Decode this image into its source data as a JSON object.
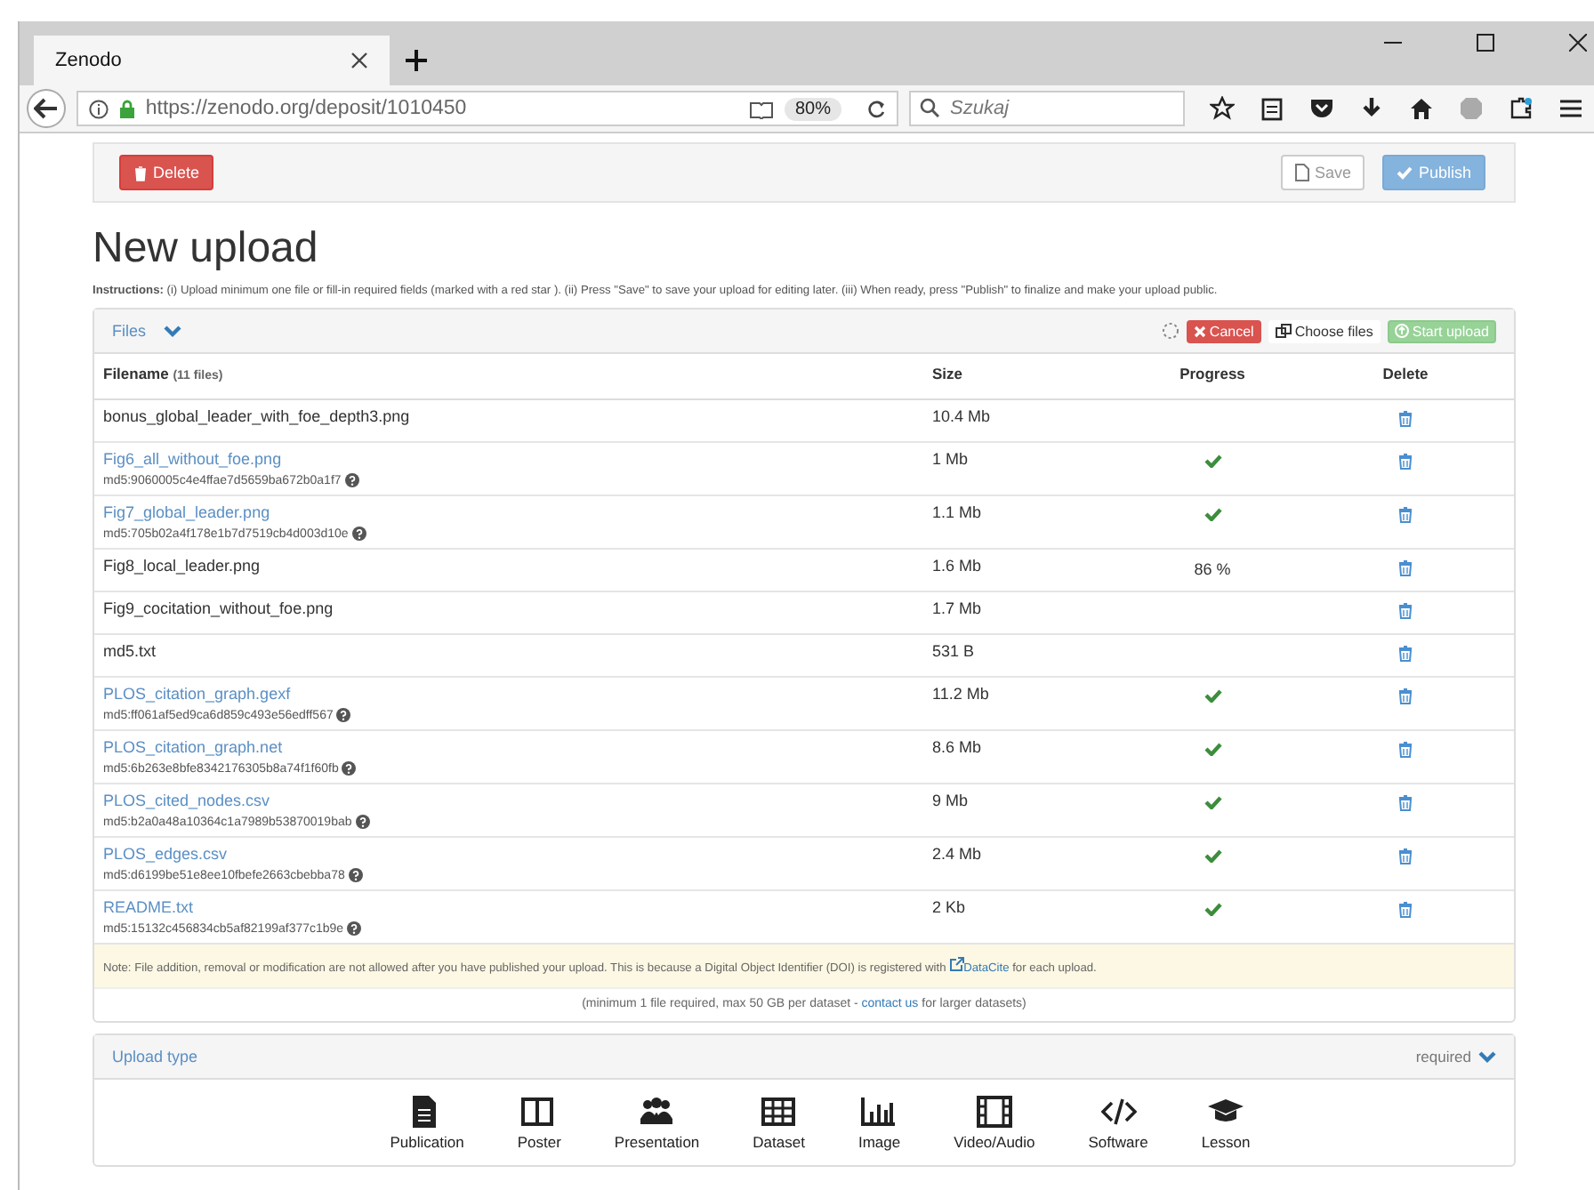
{
  "browser": {
    "tab_title": "Zenodo",
    "url": "https://zenodo.org/deposit/1010450",
    "zoom": "80%",
    "search_placeholder": "Szukaj"
  },
  "actions": {
    "delete": "Delete",
    "save": "Save",
    "publish": "Publish"
  },
  "title": "New upload",
  "instructions": "**Instructions:** (i) Upload minimum one file or fill-in required fields (marked with a red star ). (ii) Press \"Save\" to save your upload for editing later. (iii) When ready, press \"Publish\" to finalize and make your upload public.",
  "files_panel": {
    "title": "Files",
    "cancel": "Cancel",
    "choose": "Choose files",
    "start": "Start upload",
    "columns": {
      "filename": "Filename",
      "count": "(11 files)",
      "size": "Size",
      "progress": "Progress",
      "delete": "Delete"
    },
    "rows": [
      {
        "name": "bonus_global_leader_with_foe_depth3.png",
        "size": "10.4 Mb",
        "uploaded": false
      },
      {
        "name": "Fig6_all_without_foe.png",
        "md5": "md5:9060005c4e4ffae7d5659ba672b0a1f7",
        "size": "1 Mb",
        "uploaded": true
      },
      {
        "name": "Fig7_global_leader.png",
        "md5": "md5:705b02a4f178e1b7d7519cb4d003d10e",
        "size": "1.1 Mb",
        "uploaded": true
      },
      {
        "name": "Fig8_local_leader.png",
        "size": "1.6 Mb",
        "progress": "86 %",
        "uploaded": false
      },
      {
        "name": "Fig9_cocitation_without_foe.png",
        "size": "1.7 Mb",
        "uploaded": false
      },
      {
        "name": "md5.txt",
        "size": "531 B",
        "uploaded": false
      },
      {
        "name": "PLOS_citation_graph.gexf",
        "md5": "md5:ff061af5ed9ca6d859c493e56edff567",
        "size": "11.2 Mb",
        "uploaded": true
      },
      {
        "name": "PLOS_citation_graph.net",
        "md5": "md5:6b263e8bfe8342176305b8a74f1f60fb",
        "size": "8.6 Mb",
        "uploaded": true
      },
      {
        "name": "PLOS_cited_nodes.csv",
        "md5": "md5:b2a0a48a10364c1a7989b53870019bab",
        "size": "9 Mb",
        "uploaded": true
      },
      {
        "name": "PLOS_edges.csv",
        "md5": "md5:d6199be51e8ee10fbefe2663cbebba78",
        "size": "2.4 Mb",
        "uploaded": true
      },
      {
        "name": "README.txt",
        "md5": "md5:15132c456834cb5af82199af377c1b9e",
        "size": "2 Kb",
        "uploaded": true
      }
    ],
    "note": {
      "before": "Note: File addition, removal or modification are not allowed after you have published your upload. This is because a Digital Object Identifier (DOI) is registered with",
      "link": "DataCite",
      "after": "for each upload."
    },
    "limit": {
      "before": "(minimum 1 file required, max 50 GB per dataset -",
      "link": "contact us",
      "after": "for larger datasets)"
    }
  },
  "upload_type": {
    "title": "Upload type",
    "required": "required",
    "types": [
      {
        "kind": "publication",
        "label": "Publication"
      },
      {
        "kind": "poster",
        "label": "Poster"
      },
      {
        "kind": "presentation",
        "label": "Presentation"
      },
      {
        "kind": "dataset",
        "label": "Dataset"
      },
      {
        "kind": "image",
        "label": "Image"
      },
      {
        "kind": "video",
        "label": "Video/Audio"
      },
      {
        "kind": "software",
        "label": "Software"
      },
      {
        "kind": "lesson",
        "label": "Lesson"
      }
    ]
  }
}
